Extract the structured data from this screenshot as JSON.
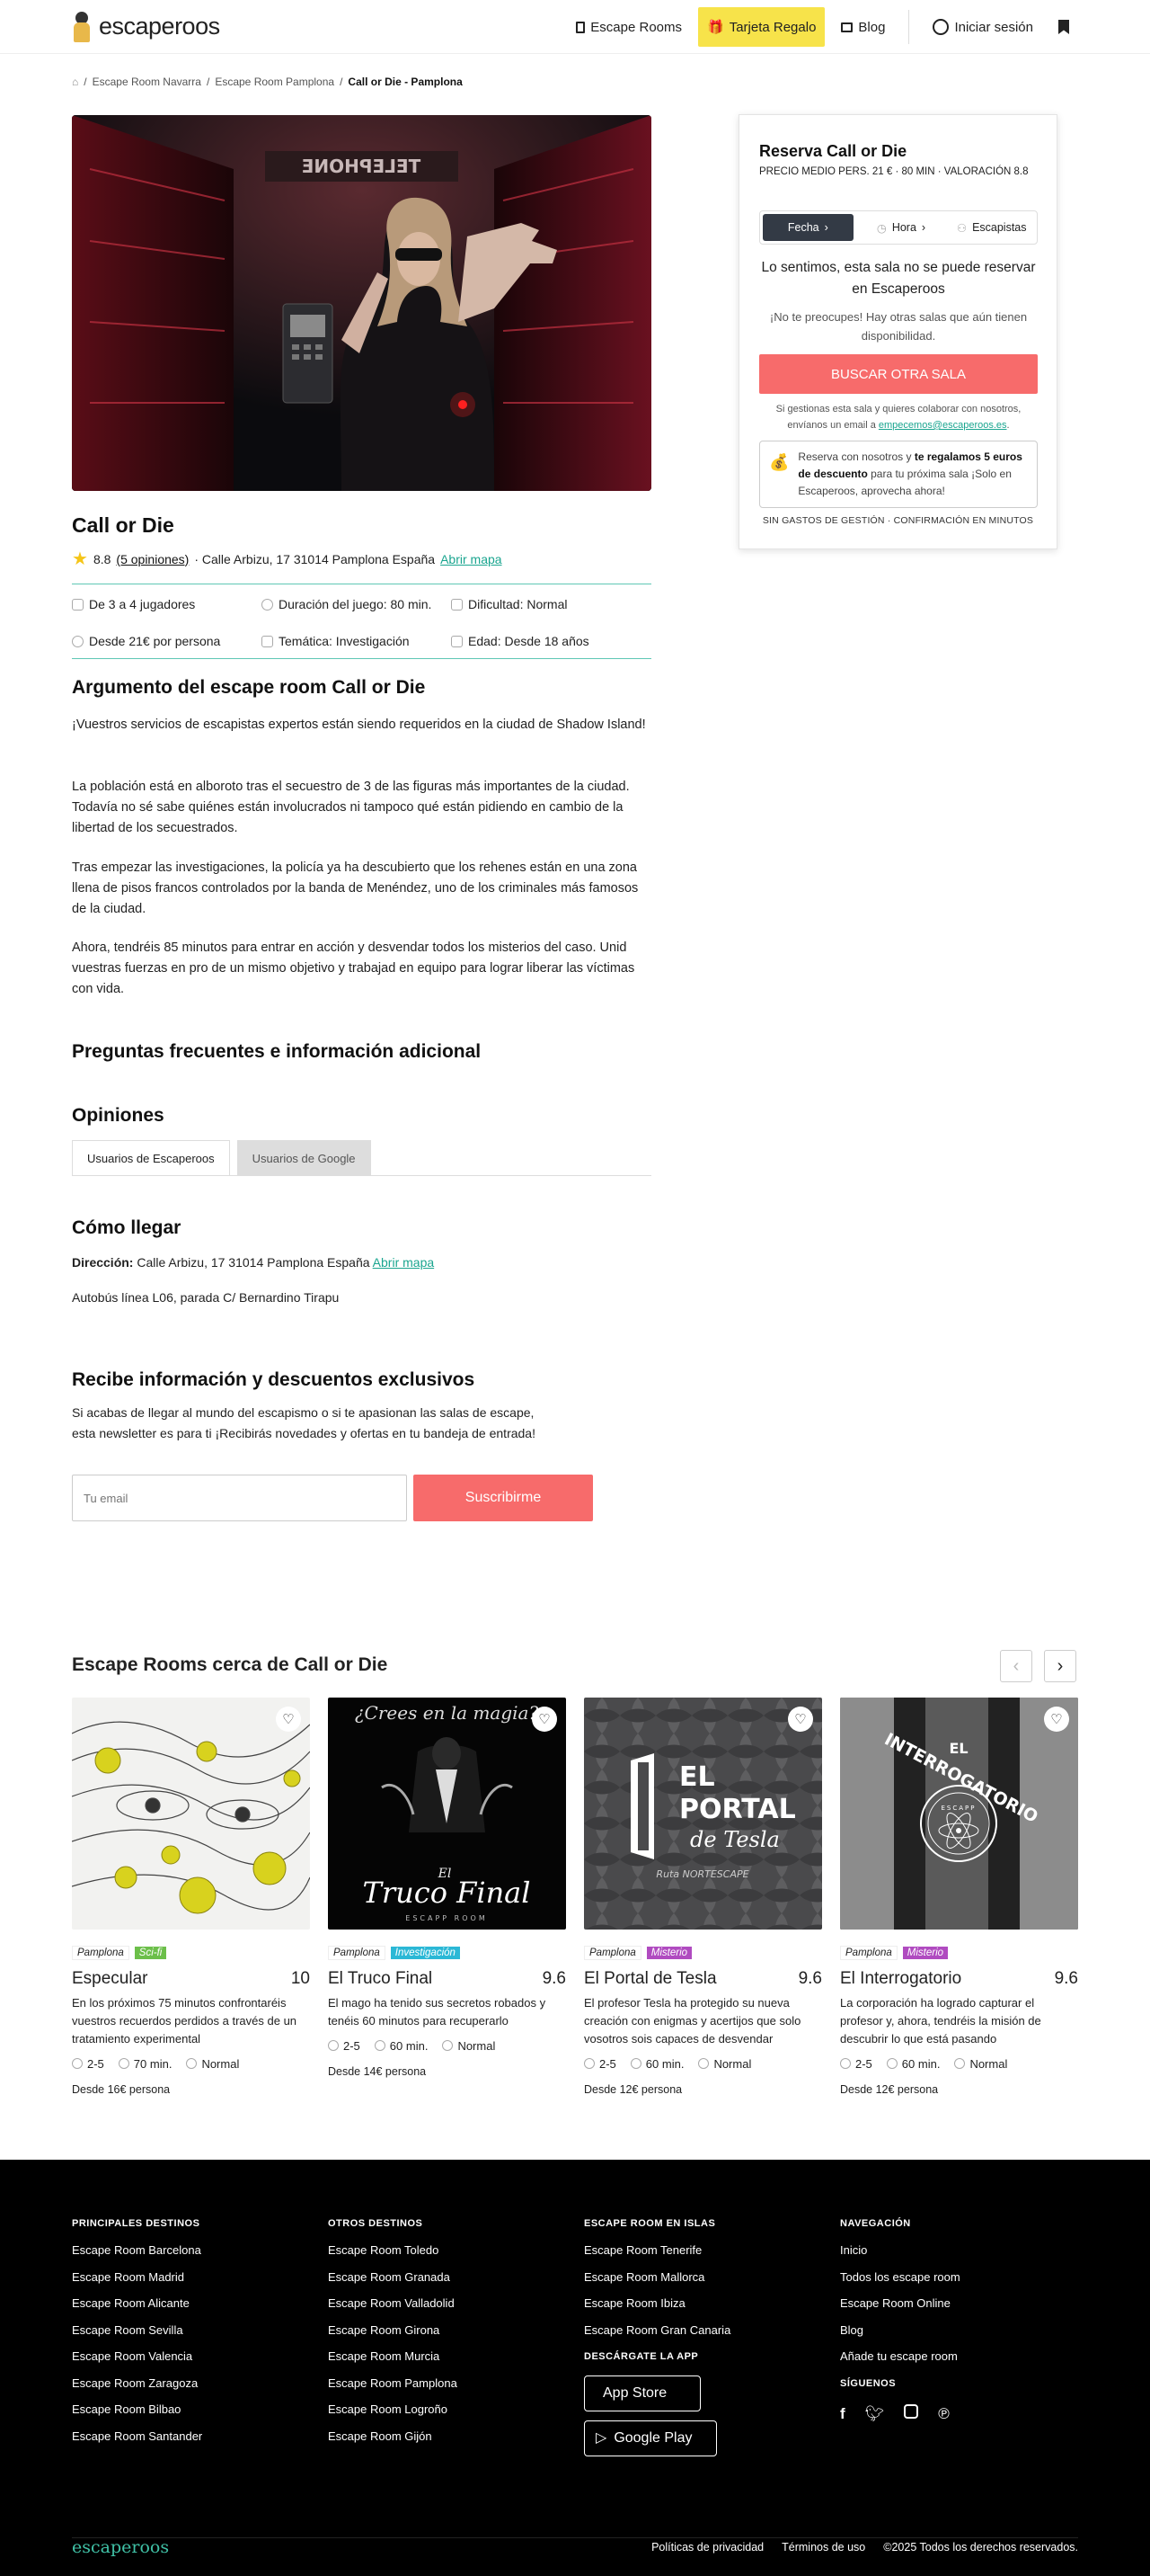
{
  "header": {
    "logo_text": "escaperoos",
    "nav": {
      "rooms": "Escape Rooms",
      "gift": "Tarjeta Regalo",
      "blog": "Blog",
      "login": "Iniciar sesión"
    }
  },
  "breadcrumb": [
    "Escape Room Navarra",
    "Escape Room Pamplona",
    "Call or Die - Pamplona"
  ],
  "room": {
    "title": "Call or Die",
    "rating": "8.8",
    "opinions": "(5 opiniones)",
    "address": "· Calle Arbizu, 17 31014 Pamplona España",
    "map_link": "Abrir mapa",
    "facts": [
      "De 3 a 4 jugadores",
      "Duración del juego: 80 min.",
      "Dificultad: Normal",
      "Desde 21€ por persona",
      "Temática: Investigación",
      "Edad: Desde 18 años"
    ],
    "plot_title": "Argumento del escape room Call or Die",
    "plot": [
      "¡Vuestros servicios de escapistas expertos están siendo requeridos en la ciudad de Shadow Island!",
      "La población está en alboroto tras el secuestro de 3 de las figuras más importantes de la ciudad. Todavía no sé sabe quiénes están involucrados ni tampoco qué están pidiendo en cambio de la libertad de los secuestrados.",
      "Tras empezar las investigaciones, la policía ya ha descubierto que los rehenes están en una zona llena de pisos francos controlados por la banda de Menéndez, uno de los criminales más famosos de la ciudad.",
      "Ahora, tendréis 85 minutos para entrar en acción y desvendar todos los misterios del caso. Unid vuestras fuerzas en pro de un mismo objetivo y trabajad en equipo para lograr liberar las víctimas con vida."
    ],
    "faq_title": "Preguntas frecuentes e información adicional",
    "opinions_title": "Opiniones",
    "tabs": [
      "Usuarios de Escaperoos",
      "Usuarios de Google"
    ],
    "howto_title": "Cómo llegar",
    "dir_label": "Dirección:",
    "dir_value": "Calle Arbizu, 17 31014 Pamplona España",
    "bus": "Autobús línea L06, parada C/ Bernardino Tirapu"
  },
  "newsletter": {
    "title": "Recibe información y descuentos exclusivos",
    "text1": "Si acabas de llegar al mundo del escapismo o si te apasionan las salas de escape,",
    "text2": "esta newsletter es para ti ¡Recibirás novedades y ofertas en tu bandeja de entrada!",
    "placeholder": "Tu email",
    "button": "Suscribirme"
  },
  "booking": {
    "title": "Reserva Call or Die",
    "subtitle": "PRECIO MEDIO PERS. 21 € · 80 MIN · VALORACIÓN 8.8",
    "seg": [
      "Fecha",
      "Hora",
      "Escapistas"
    ],
    "sorry": "Lo sentimos, esta sala no se puede reservar en Escaperoos",
    "no_worries": "¡No te preocupes! Hay otras salas que aún tienen disponibilidad.",
    "button": "BUSCAR OTRA SALA",
    "mail_text": "Si gestionas esta sala y quieres colaborar con nosotros, envíanos un email a",
    "mail": "empecemos@escaperoos.es",
    "promo_a": "Reserva con nosotros y ",
    "promo_b": "te regalamos 5 euros de descuento",
    "promo_c": " para tu próxima sala ¡Solo en Escaperoos, aprovecha ahora!",
    "foot": "SIN GASTOS DE GESTIÓN · CONFIRMACIÓN EN MINUTOS"
  },
  "nearby": {
    "title": "Escape Rooms cerca de Call or Die",
    "items": [
      {
        "city": "Pamplona",
        "tag": "Sci-fi",
        "tag_color": "#6cbf4a",
        "name": "Especular",
        "score": "10",
        "desc": "En los próximos 75 minutos confrontaréis vuestros recuerdos perdidos a través de un tratamiento experimental",
        "players": "2-5",
        "time": "70 min.",
        "level": "Normal",
        "price": "Desde 16€ persona"
      },
      {
        "city": "Pamplona",
        "tag": "Investigación",
        "tag_color": "#2bb8d6",
        "name": "El Truco Final",
        "score": "9.6",
        "desc": "El mago ha tenido sus secretos robados y tenéis 60 minutos para recuperarlo",
        "players": "2-5",
        "time": "60 min.",
        "level": "Normal",
        "price": "Desde 14€ persona"
      },
      {
        "city": "Pamplona",
        "tag": "Misterio",
        "tag_color": "#b04bc0",
        "name": "El Portal de Tesla",
        "score": "9.6",
        "desc": "El profesor Tesla ha protegido su nueva creación con enigmas y acertijos que solo vosotros sois capaces de desvendar",
        "players": "2-5",
        "time": "60 min.",
        "level": "Normal",
        "price": "Desde 12€ persona"
      },
      {
        "city": "Pamplona",
        "tag": "Misterio",
        "tag_color": "#b04bc0",
        "name": "El Interrogatorio",
        "score": "9.6",
        "desc": "La corporación ha logrado capturar el profesor y, ahora, tendréis la misión de descubrir lo que está pasando",
        "players": "2-5",
        "time": "60 min.",
        "level": "Normal",
        "price": "Desde 12€ persona"
      }
    ],
    "img_text": {
      "truco_top": "¿Crees en la magia?",
      "truco_el": "El",
      "truco_name": "Truco Final",
      "truco_sub": "ESCAPP ROOM",
      "tesla_1": "EL",
      "tesla_2": "PORTAL",
      "tesla_3": "de Tesla",
      "tesla_4": "Ruta NORTESCAPE",
      "inter_1": "EL",
      "inter_2": "INTERROGATORIO",
      "inter_3": "ESCAPP"
    }
  },
  "footer": {
    "col1": {
      "title": "PRINCIPALES DESTINOS",
      "links": [
        "Escape Room Barcelona",
        "Escape Room Madrid",
        "Escape Room Alicante",
        "Escape Room Sevilla",
        "Escape Room Valencia",
        "Escape Room Zaragoza",
        "Escape Room Bilbao",
        "Escape Room Santander"
      ]
    },
    "col2": {
      "title": "OTROS DESTINOS",
      "links": [
        "Escape Room Toledo",
        "Escape Room Granada",
        "Escape Room Valladolid",
        "Escape Room Girona",
        "Escape Room Murcia",
        "Escape Room Pamplona",
        "Escape Room Logroño",
        "Escape Room Gijón"
      ]
    },
    "col3": {
      "title": "ESCAPE ROOM EN ISLAS",
      "links": [
        "Escape Room Tenerife",
        "Escape Room Mallorca",
        "Escape Room Ibiza",
        "Escape Room Gran Canaria"
      ],
      "app_title": "DESCÁRGATE LA APP",
      "app_store": "App Store",
      "google_play": "Google Play"
    },
    "col4": {
      "title": "NAVEGACIÓN",
      "links": [
        "Inicio",
        "Todos los escape room",
        "Escape Room Online",
        "Blog",
        "Añade tu escape room"
      ],
      "social_title": "SÍGUENOS"
    },
    "logo": "escaperoos",
    "privacy": "Políticas de privacidad",
    "terms": "Términos de uso",
    "copy": "©2025 Todos los derechos reservados."
  },
  "hero_sign": "TELEPHONE"
}
